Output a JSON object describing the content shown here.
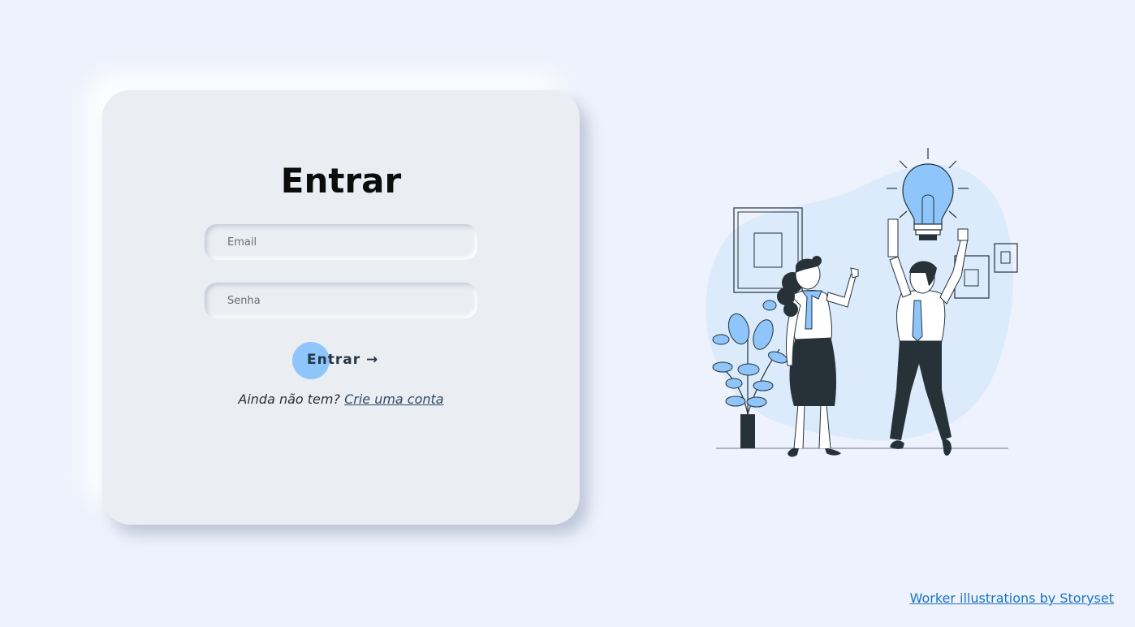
{
  "login": {
    "title": "Entrar",
    "email_placeholder": "Email",
    "password_placeholder": "Senha",
    "submit_label": "Entrar →",
    "signup_prompt": "Ainda não tem?",
    "signup_link": "Crie uma conta"
  },
  "footer": {
    "credit_link": "Worker illustrations by Storyset"
  },
  "colors": {
    "background": "#eef2fc",
    "card": "#eaedf1",
    "accent": "#8ec5fb",
    "link": "#1a73c9",
    "dark": "#263238"
  }
}
